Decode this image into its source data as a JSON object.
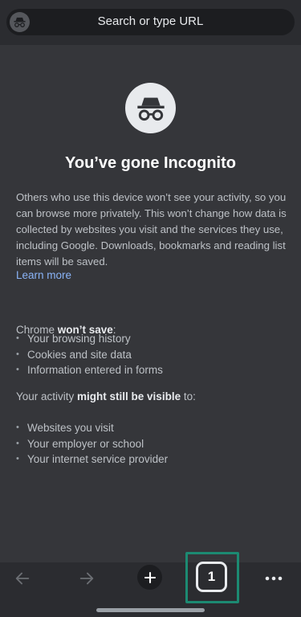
{
  "omnibox": {
    "placeholder": "Search or type URL",
    "icon": "incognito-icon"
  },
  "hero": {
    "icon": "incognito-icon",
    "title": "You’ve gone Incognito",
    "description": "Others who use this device won’t see your activity, so you can browse more privately. This won’t change how data is collected by websites you visit and the services they use, including Google. Downloads, bookmarks and reading list items will be saved.",
    "learn_more": "Learn more"
  },
  "wont_save": {
    "prefix": "Chrome ",
    "emphasis": "won’t save",
    "suffix": ":",
    "items": [
      "Your browsing history",
      "Cookies and site data",
      "Information entered in forms"
    ]
  },
  "still_visible": {
    "prefix": "Your activity ",
    "emphasis": "might still be visible",
    "suffix": " to:",
    "items": [
      "Websites you visit",
      "Your employer or school",
      "Your internet service provider"
    ]
  },
  "toolbar": {
    "back_icon": "back-arrow-icon",
    "forward_icon": "forward-arrow-icon",
    "new_tab_icon": "plus-icon",
    "tab_count": "1",
    "menu_icon": "more-dots-icon"
  },
  "colors": {
    "background": "#35363a",
    "link": "#8ab4f8",
    "highlight": "#1c8a72"
  }
}
